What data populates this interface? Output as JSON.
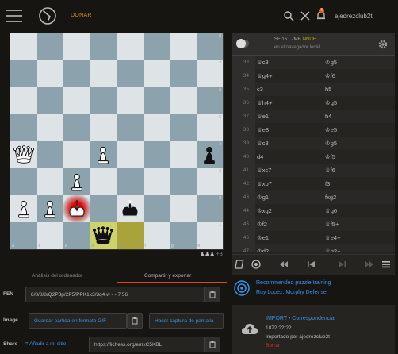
{
  "header": {
    "donate": "DONAR",
    "username": "ajedrezclub2t",
    "notifications": "4"
  },
  "board": {
    "ranks": [
      "8",
      "7",
      "6",
      "5",
      "4",
      "3",
      "2",
      "1"
    ],
    "files": [
      "a",
      "b",
      "c",
      "d",
      "e",
      "f",
      "g",
      "h"
    ],
    "fen": "8/8/8/8/Q2P3p/2P5/PPK1k3/3q4 w - - 7 56",
    "pieces": [
      {
        "square": "a4",
        "piece": "wQ"
      },
      {
        "square": "d4",
        "piece": "wP"
      },
      {
        "square": "h4",
        "piece": "bP"
      },
      {
        "square": "c3",
        "piece": "wP"
      },
      {
        "square": "a2",
        "piece": "wP"
      },
      {
        "square": "b2",
        "piece": "wP"
      },
      {
        "square": "c2",
        "piece": "wK"
      },
      {
        "square": "e2",
        "piece": "bK"
      },
      {
        "square": "d1",
        "piece": "bQ"
      }
    ],
    "check_square": "c2",
    "last_move": [
      "d1",
      "e1"
    ],
    "material_diff": "+3"
  },
  "engine": {
    "name": "SF 16 · 7MB",
    "nnue": "NNUE",
    "sub": "en el navegador local"
  },
  "moves": [
    {
      "n": "33",
      "w": "♕c8",
      "b": "♔g5"
    },
    {
      "n": "34",
      "w": "♕g4+",
      "b": "♔f6"
    },
    {
      "n": "35",
      "w": "c3",
      "b": "h5"
    },
    {
      "n": "36",
      "w": "♕h4+",
      "b": "♔g5"
    },
    {
      "n": "37",
      "w": "♕e1",
      "b": "h4"
    },
    {
      "n": "38",
      "w": "♕e8",
      "b": "♔e5"
    },
    {
      "n": "39",
      "w": "♕c8",
      "b": "♔g5"
    },
    {
      "n": "40",
      "w": "d4",
      "b": "♔f5"
    },
    {
      "n": "41",
      "w": "♕xc7",
      "b": "♕f6"
    },
    {
      "n": "42",
      "w": "♕xb7",
      "b": "f3"
    },
    {
      "n": "43",
      "w": "♔g1",
      "b": "fxg2"
    },
    {
      "n": "44",
      "w": "♔xg2",
      "b": "♕g6"
    },
    {
      "n": "45",
      "w": "♔f2",
      "b": "♕f5+"
    },
    {
      "n": "46",
      "w": "♔e1",
      "b": "♕e4+"
    },
    {
      "n": "47",
      "w": "♔d2",
      "b": "♕g2+"
    }
  ],
  "tabs": {
    "analysis": "Análisis del ordenador",
    "share": "Compartir y exportar"
  },
  "fields": {
    "fen_label": "FEN",
    "fen_value": "8/8/8/8/Q2P3p/2P5/PPK1k3/3q4 w - - 7 56",
    "image_label": "Image",
    "image_save": "Guardar partida en formato GIF",
    "image_capture": "Hacer captura de pantalla",
    "share_label": "Share",
    "share_embed": "Añadir a mi sitio",
    "share_url": "https://lichess.org/emxC5KBL"
  },
  "puzzle": {
    "line1": "Recommended puzzle training",
    "line2": "Ruy Lopez: Morphy Defense"
  },
  "import": {
    "title": "IMPORT • Correspondencia",
    "date": "1872.??.??",
    "by": "Importado por ajedrezclub2t",
    "delete": "Borrar"
  },
  "colors": {
    "accent": "#d64f00",
    "link": "#3692e7",
    "donate": "#d59120",
    "light_square": "#dee3e6",
    "dark_square": "#8ca2ad"
  }
}
